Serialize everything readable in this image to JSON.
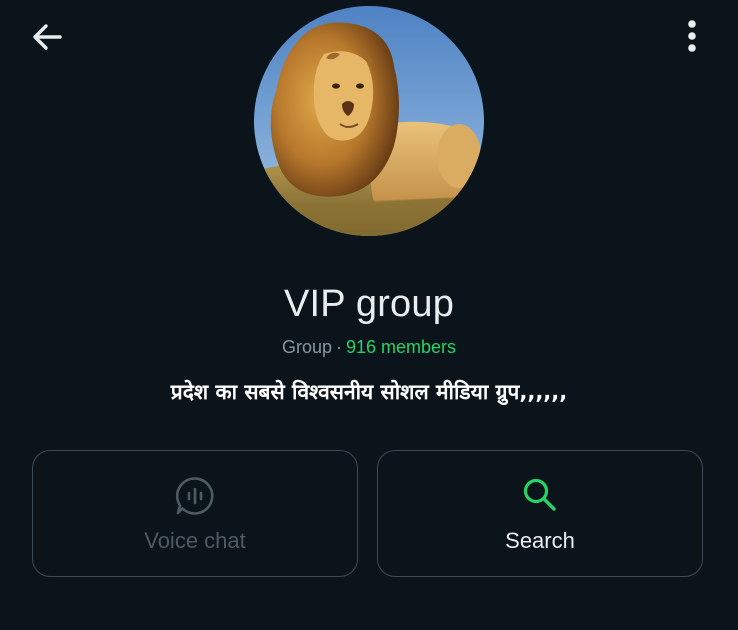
{
  "header": {
    "back_icon": "arrow-left-icon",
    "menu_icon": "more-vertical-icon"
  },
  "profile": {
    "avatar_subject": "lion photo",
    "title": "VIP group",
    "type_label": "Group",
    "separator": "·",
    "members_label": "916 members",
    "description": "प्रदेश का सबसे विश्वसनीय सोशल मीडिया ग्रुप,,,,,,"
  },
  "actions": {
    "voice_chat": {
      "label": "Voice chat",
      "icon": "voice-chat-icon",
      "enabled": false
    },
    "search": {
      "label": "Search",
      "icon": "search-icon",
      "enabled": true
    }
  },
  "colors": {
    "background": "#0b141a",
    "accent": "#25d366",
    "muted_text": "#8696a0",
    "card_border": "#3b4a54",
    "disabled": "#4e5a62"
  }
}
